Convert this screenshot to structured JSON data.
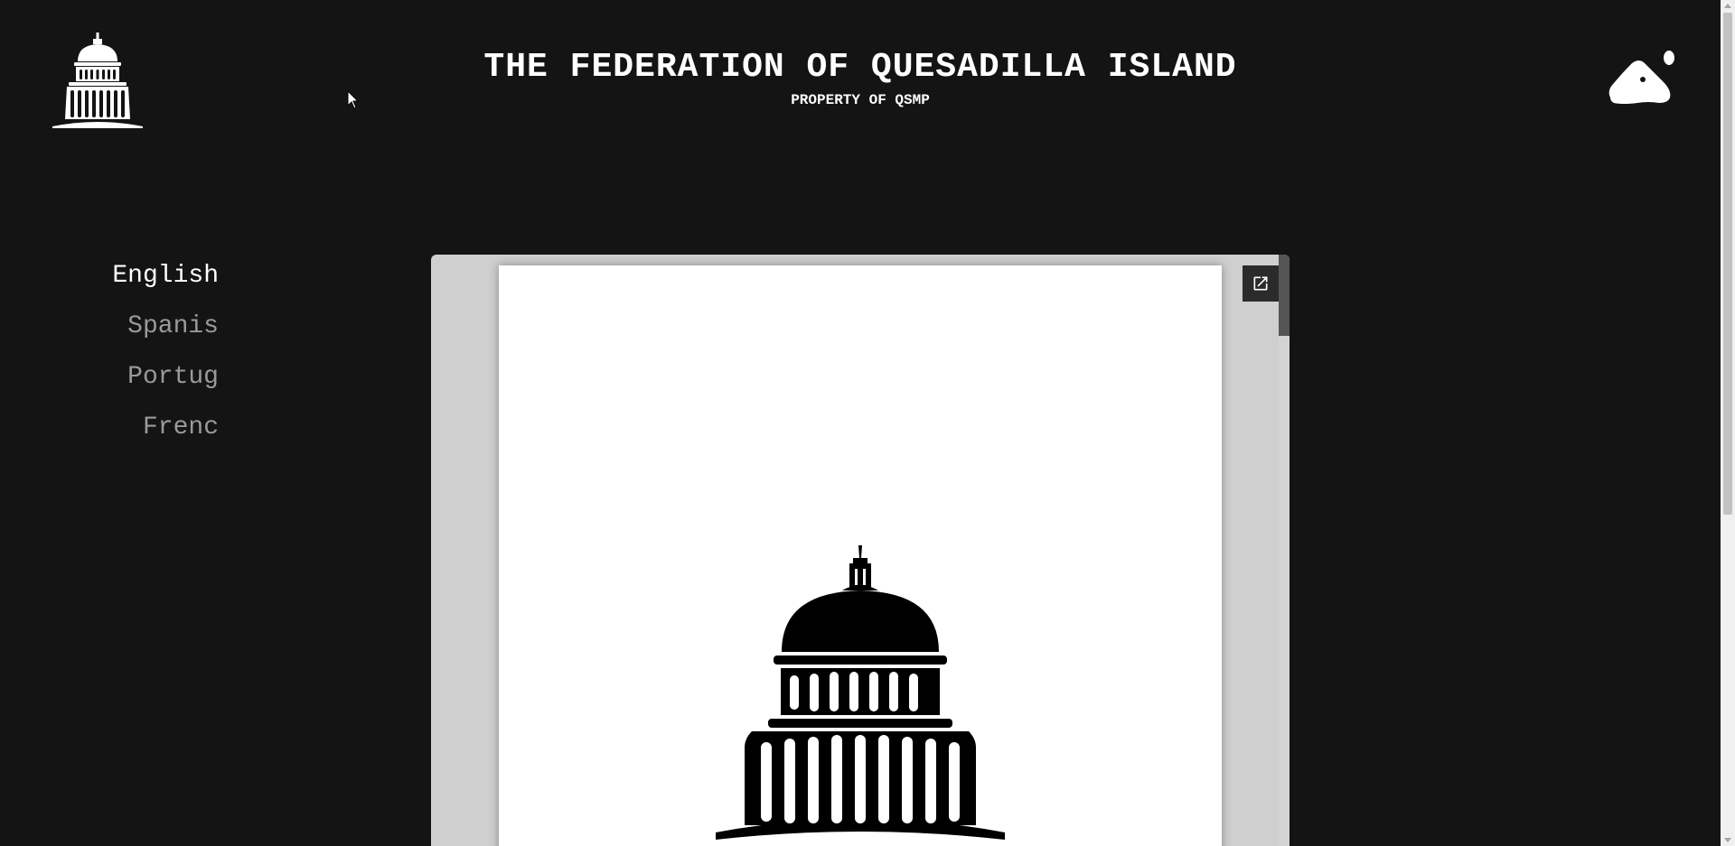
{
  "header": {
    "title": "THE FEDERATION OF QUESADILLA ISLAND",
    "subtitle": "PROPERTY OF QSMP",
    "left_logo_icon": "capitol-dome-icon",
    "right_logo_icon": "island-blob-icon"
  },
  "languages": {
    "items": [
      {
        "label": "English",
        "active": true
      },
      {
        "label": "Spanis",
        "active": false
      },
      {
        "label": "Portug",
        "active": false
      },
      {
        "label": "Frenc",
        "active": false
      }
    ]
  },
  "viewer": {
    "popout_icon": "open-in-new-icon",
    "emblem_icon": "capitol-dome-icon"
  },
  "colors": {
    "background": "#141414",
    "text": "#ffffff",
    "inactive_text": "#9a9a9a",
    "viewer_bg": "#cfcfcf"
  }
}
